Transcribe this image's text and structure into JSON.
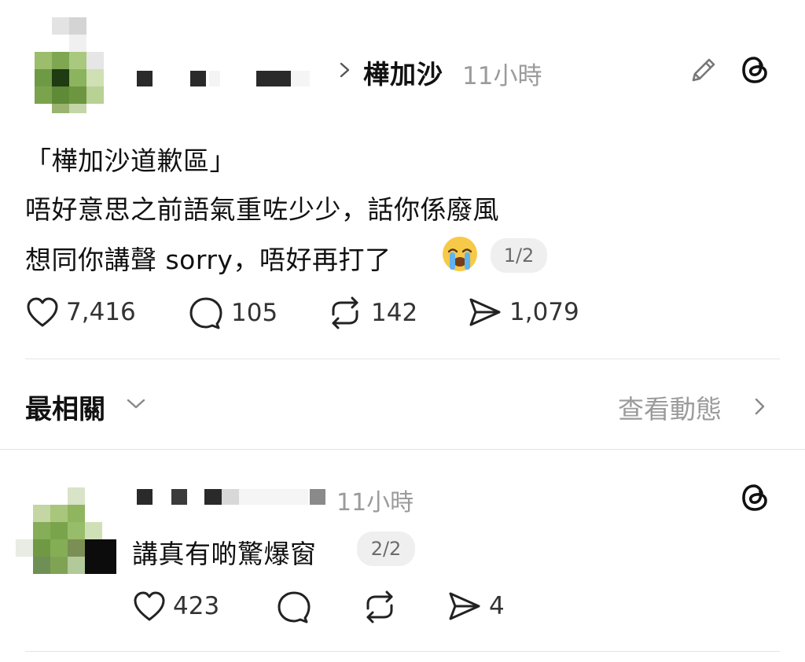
{
  "post": {
    "topic": "樺加沙",
    "time": "11小時",
    "lines": [
      "「樺加沙道歉區」",
      "唔好意思之前語氣重咗少少，話你係廢風",
      "想同你講聲 sorry，唔好再打了"
    ],
    "emoji": "loudly-crying-face",
    "pager": "1/2",
    "stats": {
      "likes": "7,416",
      "replies": "105",
      "reposts": "142",
      "shares": "1,079"
    }
  },
  "sort_bar": {
    "label": "最相關",
    "activity_link": "查看動態"
  },
  "reply": {
    "time": "11小時",
    "text": "講真有啲驚爆窗",
    "pager": "2/2",
    "stats": {
      "likes": "423",
      "replies": "",
      "reposts": "",
      "shares": "4"
    }
  },
  "icons": [
    "pencil-icon",
    "threads-icon",
    "heart-icon",
    "comment-icon",
    "repost-icon",
    "share-icon",
    "chevron-right-icon",
    "chevron-down-icon"
  ]
}
